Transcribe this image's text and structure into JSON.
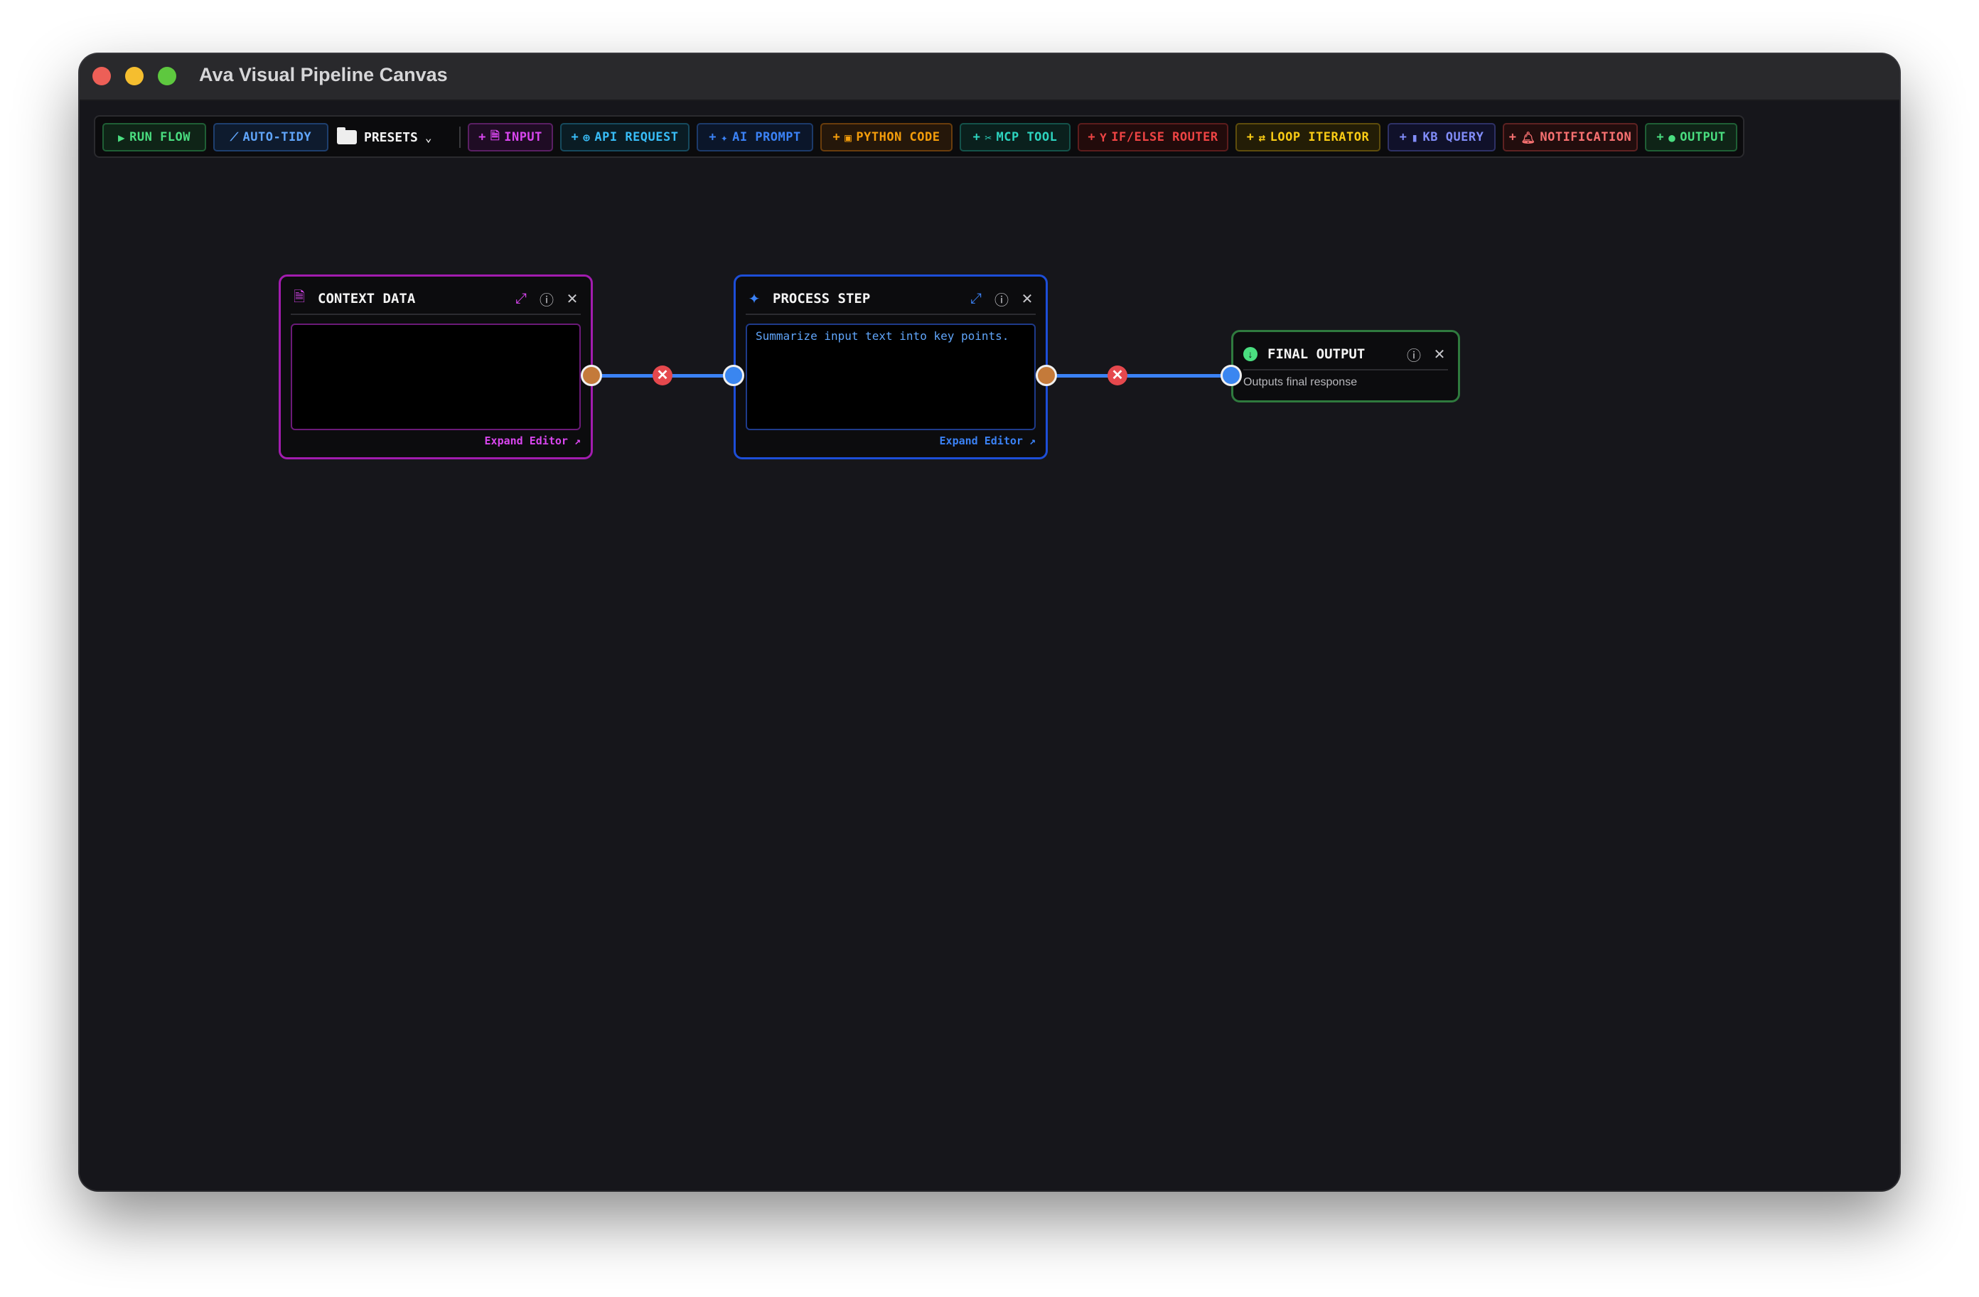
{
  "window": {
    "title": "Ava Visual Pipeline Canvas"
  },
  "toolbar": {
    "run_flow": "RUN FLOW",
    "auto_tidy": "AUTO-TIDY",
    "presets": "PRESETS",
    "add_buttons": [
      {
        "label": "INPUT",
        "icon": "file-sparkle-icon"
      },
      {
        "label": "API REQUEST",
        "icon": "globe-icon"
      },
      {
        "label": "AI PROMPT",
        "icon": "sparkle-icon"
      },
      {
        "label": "PYTHON CODE",
        "icon": "code-icon"
      },
      {
        "label": "MCP TOOL",
        "icon": "tools-icon"
      },
      {
        "label": "IF/ELSE ROUTER",
        "icon": "branch-icon"
      },
      {
        "label": "LOOP ITERATOR",
        "icon": "loop-icon"
      },
      {
        "label": "KB QUERY",
        "icon": "book-icon"
      },
      {
        "label": "NOTIFICATION",
        "icon": "bell-icon"
      },
      {
        "label": "OUTPUT",
        "icon": "download-icon"
      }
    ],
    "plus": "+"
  },
  "nodes": {
    "context": {
      "title": "CONTEXT DATA",
      "value": "",
      "expand": "Expand Editor ↗"
    },
    "process": {
      "title": "PROCESS STEP",
      "value": "Summarize input text into key points.",
      "expand": "Expand Editor ↗"
    },
    "output": {
      "title": "FINAL OUTPUT",
      "description": "Outputs final response"
    }
  },
  "colors": {
    "run": "#4ade80",
    "tidy": "#60a5fa",
    "input": "#d946ef",
    "api": "#38bdf8",
    "ai": "#3b82f6",
    "python": "#f59e0b",
    "mcp": "#2dd4bf",
    "router": "#ef4444",
    "loop": "#facc15",
    "kb": "#818cf8",
    "notify": "#f87171",
    "output": "#4ade80",
    "wire": "#3b82f6",
    "delete": "#e5484d"
  }
}
